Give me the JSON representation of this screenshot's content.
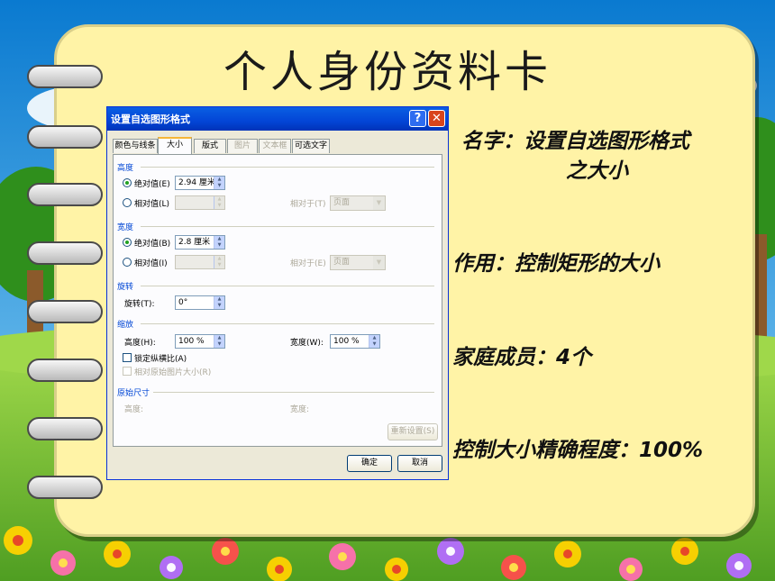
{
  "slide": {
    "title": "个人身份资料卡",
    "info": {
      "name_line1": "名字：设置自选图形格式",
      "name_line2": "之大小",
      "purpose": "作用：控制矩形的大小",
      "family": "家庭成员：4个",
      "precision": "控制大小精确程度：100%"
    }
  },
  "dialog": {
    "title": "设置自选图形格式",
    "help_label": "?",
    "close_label": "✕",
    "tabs": [
      {
        "label": "颜色与线条",
        "state": "normal"
      },
      {
        "label": "大小",
        "state": "active"
      },
      {
        "label": "版式",
        "state": "normal"
      },
      {
        "label": "图片",
        "state": "disabled"
      },
      {
        "label": "文本框",
        "state": "disabled"
      },
      {
        "label": "可选文字",
        "state": "normal"
      }
    ],
    "height": {
      "section": "高度",
      "absolute_label": "绝对值(E)",
      "absolute_value": "2.94 厘米",
      "relative_label": "相对值(L)",
      "relative_value": "",
      "relative_to_label": "相对于(T)",
      "relative_to_value": "页面"
    },
    "width": {
      "section": "宽度",
      "absolute_label": "绝对值(B)",
      "absolute_value": "2.8 厘米",
      "relative_label": "相对值(I)",
      "relative_value": "",
      "relative_to_label": "相对于(E)",
      "relative_to_value": "页面"
    },
    "rotation": {
      "section": "旋转",
      "label": "旋转(T):",
      "value": "0°"
    },
    "scale": {
      "section": "缩放",
      "height_label": "高度(H):",
      "height_value": "100 %",
      "width_label": "宽度(W):",
      "width_value": "100 %",
      "lock_label": "锁定纵横比(A)",
      "relative_original_label": "相对原始图片大小(R)"
    },
    "original": {
      "section": "原始尺寸",
      "height_label": "高度:",
      "width_label": "宽度:",
      "reset_label": "重新设置(S)"
    },
    "ok_label": "确定",
    "cancel_label": "取消"
  },
  "colors": {
    "card": "#fff3a6",
    "sky": "#1d9be0",
    "titlebar": "#0345d6",
    "grass": "#7fc43a"
  }
}
